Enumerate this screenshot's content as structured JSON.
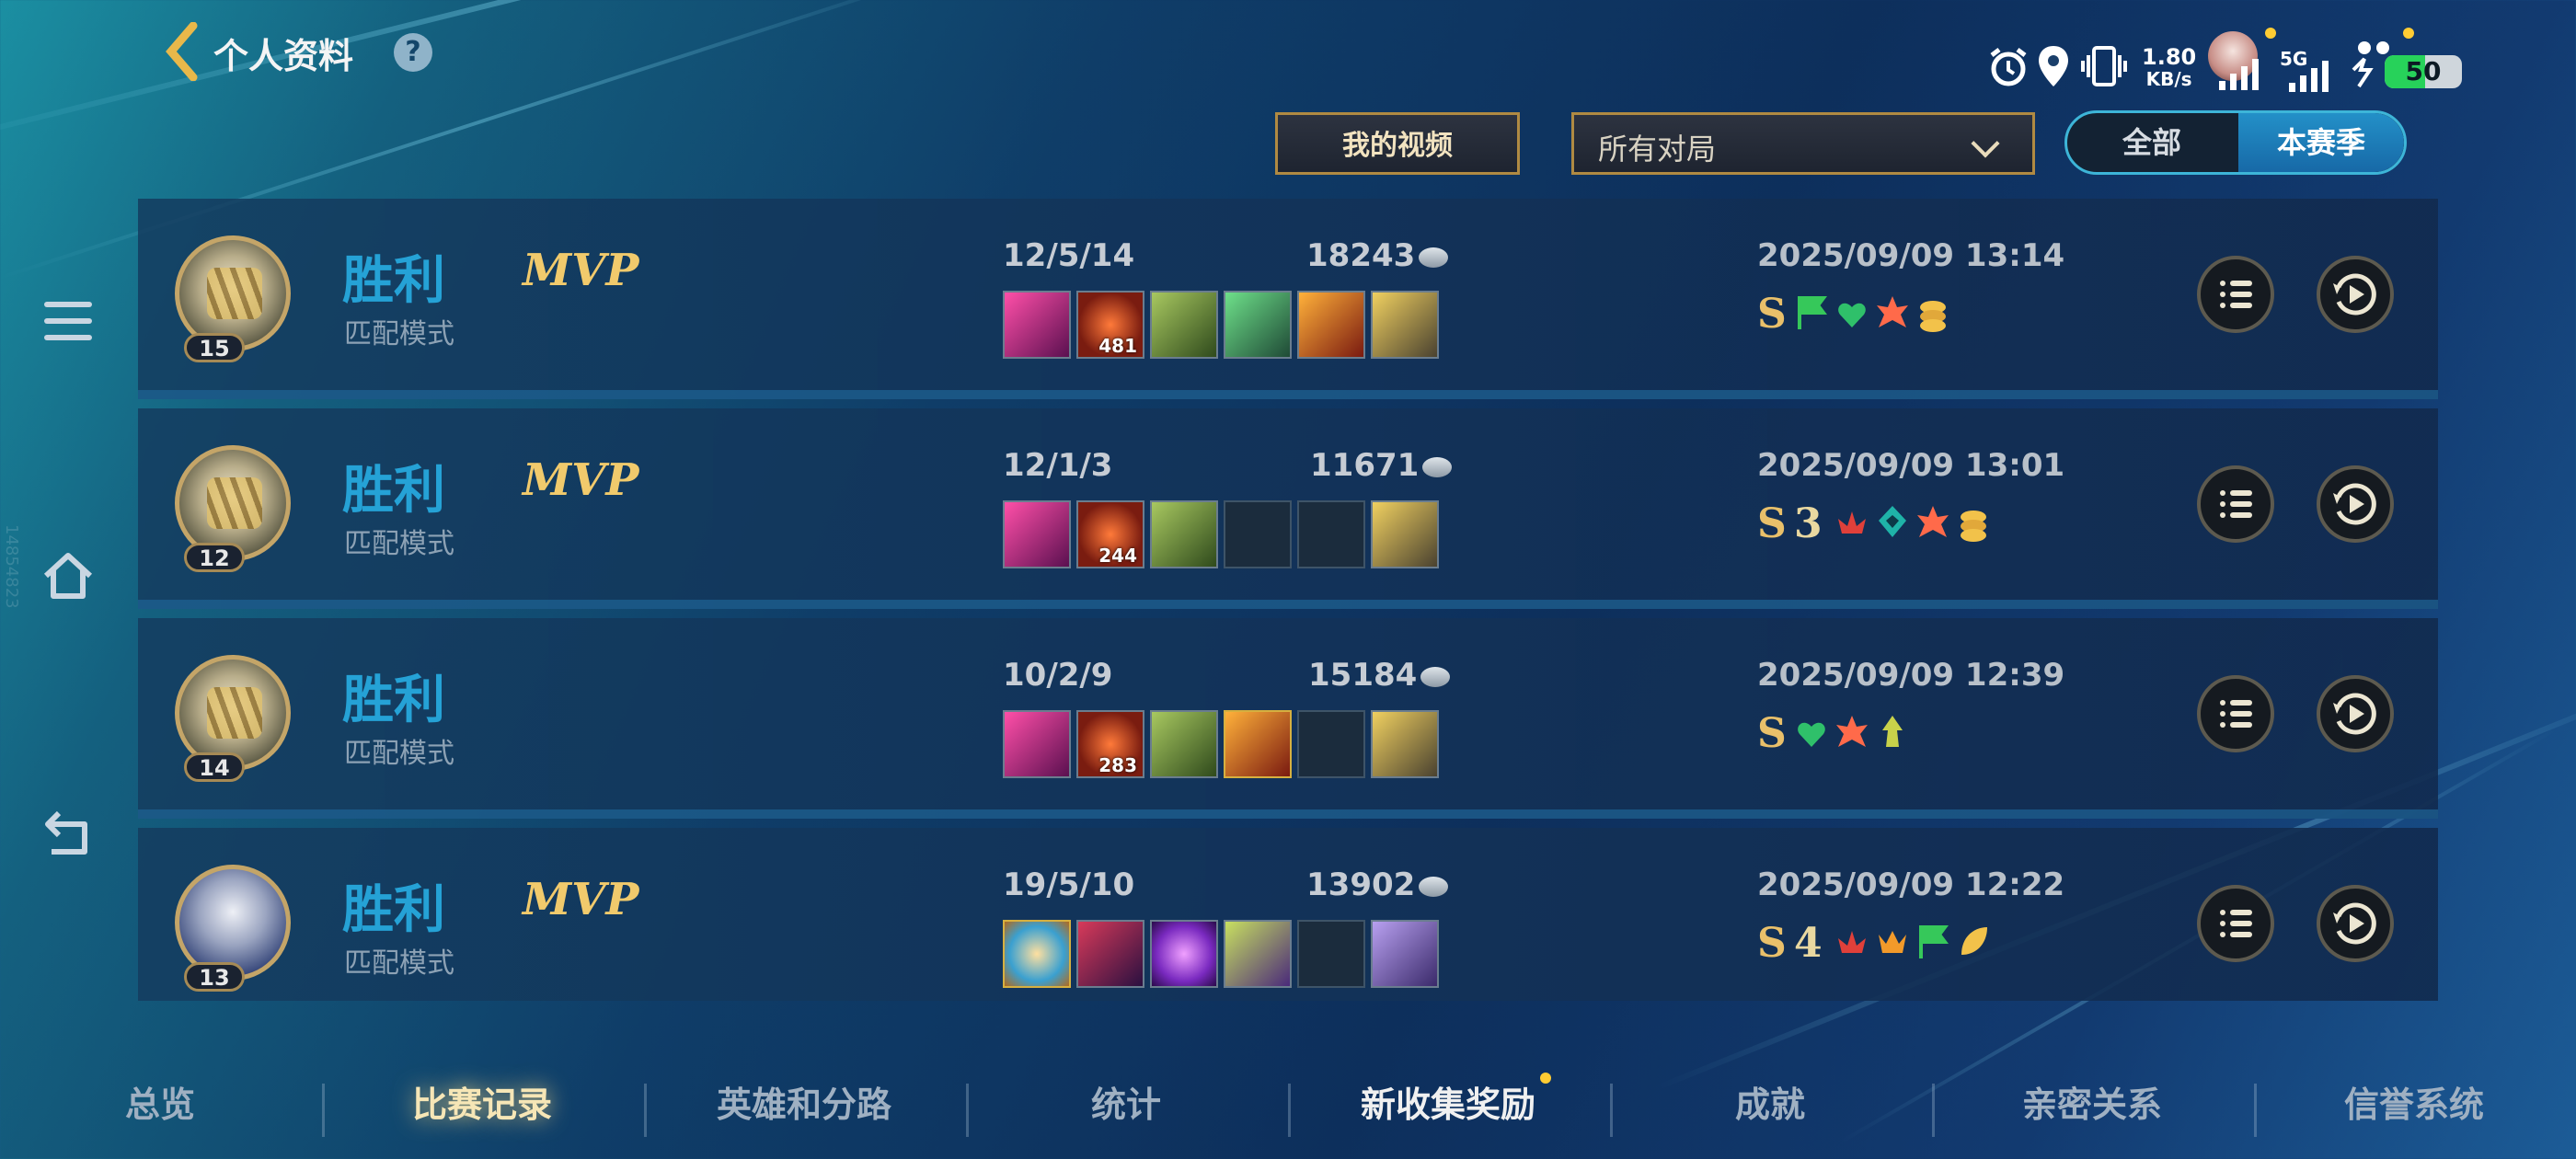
{
  "status_bar": {
    "net_speed": "1.80",
    "net_unit": "KB/s",
    "network": "5G",
    "battery": "50"
  },
  "header": {
    "title": "个人资料",
    "help": "?",
    "my_video": "我的视频",
    "filter_selected": "所有对局",
    "toggle": [
      "全部",
      "本赛季"
    ],
    "toggle_active": "本赛季"
  },
  "side_watermark": "14854823",
  "matches": [
    {
      "result": "胜利",
      "mode": "匹配模式",
      "mvp": "MVP",
      "level": "15",
      "kda": "12/5/14",
      "gold": "18243",
      "datetime": "2025/09/09 13:14",
      "grade": "S",
      "item_count": "481"
    },
    {
      "result": "胜利",
      "mode": "匹配模式",
      "mvp": "MVP",
      "level": "12",
      "kda": "12/1/3",
      "gold": "11671",
      "datetime": "2025/09/09 13:01",
      "grade": "S",
      "streak": "3",
      "item_count": "244"
    },
    {
      "result": "胜利",
      "mode": "匹配模式",
      "mvp": "",
      "level": "14",
      "kda": "10/2/9",
      "gold": "15184",
      "datetime": "2025/09/09 12:39",
      "grade": "S",
      "item_count": "283"
    },
    {
      "result": "胜利",
      "mode": "匹配模式",
      "mvp": "MVP",
      "level": "13",
      "kda": "19/5/10",
      "gold": "13902",
      "datetime": "2025/09/09 12:22",
      "grade": "S",
      "streak": "4"
    }
  ],
  "bottom_nav": [
    "总览",
    "比赛记录",
    "英雄和分路",
    "统计",
    "新收集奖励",
    "成就",
    "亲密关系",
    "信誉系统"
  ],
  "bottom_nav_active": "比赛记录"
}
